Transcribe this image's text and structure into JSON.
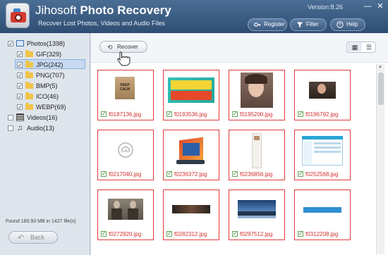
{
  "app": {
    "title_light": "Jihosoft",
    "title_bold": "Photo Recovery",
    "subtitle": "Recover Lost Photos, Videos and Audio Files",
    "version": "Version:8.26",
    "win_minimize": "—",
    "win_close": "✕"
  },
  "header_buttons": {
    "register": "Register",
    "filter": "Filter",
    "help": "Help"
  },
  "tree": {
    "photos": "Photos(1398)",
    "gif": "GIF(329)",
    "jpg": "JPG(242)",
    "png": "PNG(707)",
    "bmp": "BMP(5)",
    "ico": "ICO(46)",
    "webp": "WEBP(69)",
    "videos": "Videos(16)",
    "audio": "Audio(13)"
  },
  "status": {
    "found": "Found 185.93 MB in 1427 file(s)"
  },
  "buttons": {
    "back": "Back",
    "recover": "Recover"
  },
  "files": [
    {
      "name": "f0187136.jpg"
    },
    {
      "name": "f0193536.jpg"
    },
    {
      "name": "f0195200.jpg"
    },
    {
      "name": "f0196792.jpg"
    },
    {
      "name": "f0217040.jpg"
    },
    {
      "name": "f0236372.jpg"
    },
    {
      "name": "f0236856.jpg"
    },
    {
      "name": "f0252568.jpg"
    },
    {
      "name": "f0272920.jpg"
    },
    {
      "name": "f0282312.jpg"
    },
    {
      "name": "f0297512.jpg"
    },
    {
      "name": "f0312208.jpg"
    }
  ],
  "colors": {
    "header": "#3a5b80",
    "accent_red": "#e03b3b",
    "caption_red": "#d0312d"
  },
  "icons": {
    "register": "register-icon",
    "filter": "filter-icon",
    "help": "help-icon",
    "back": "back-arrow-icon",
    "recover": "recover-icon",
    "grid_view": "grid-view-icon",
    "list_view": "list-view-icon"
  }
}
